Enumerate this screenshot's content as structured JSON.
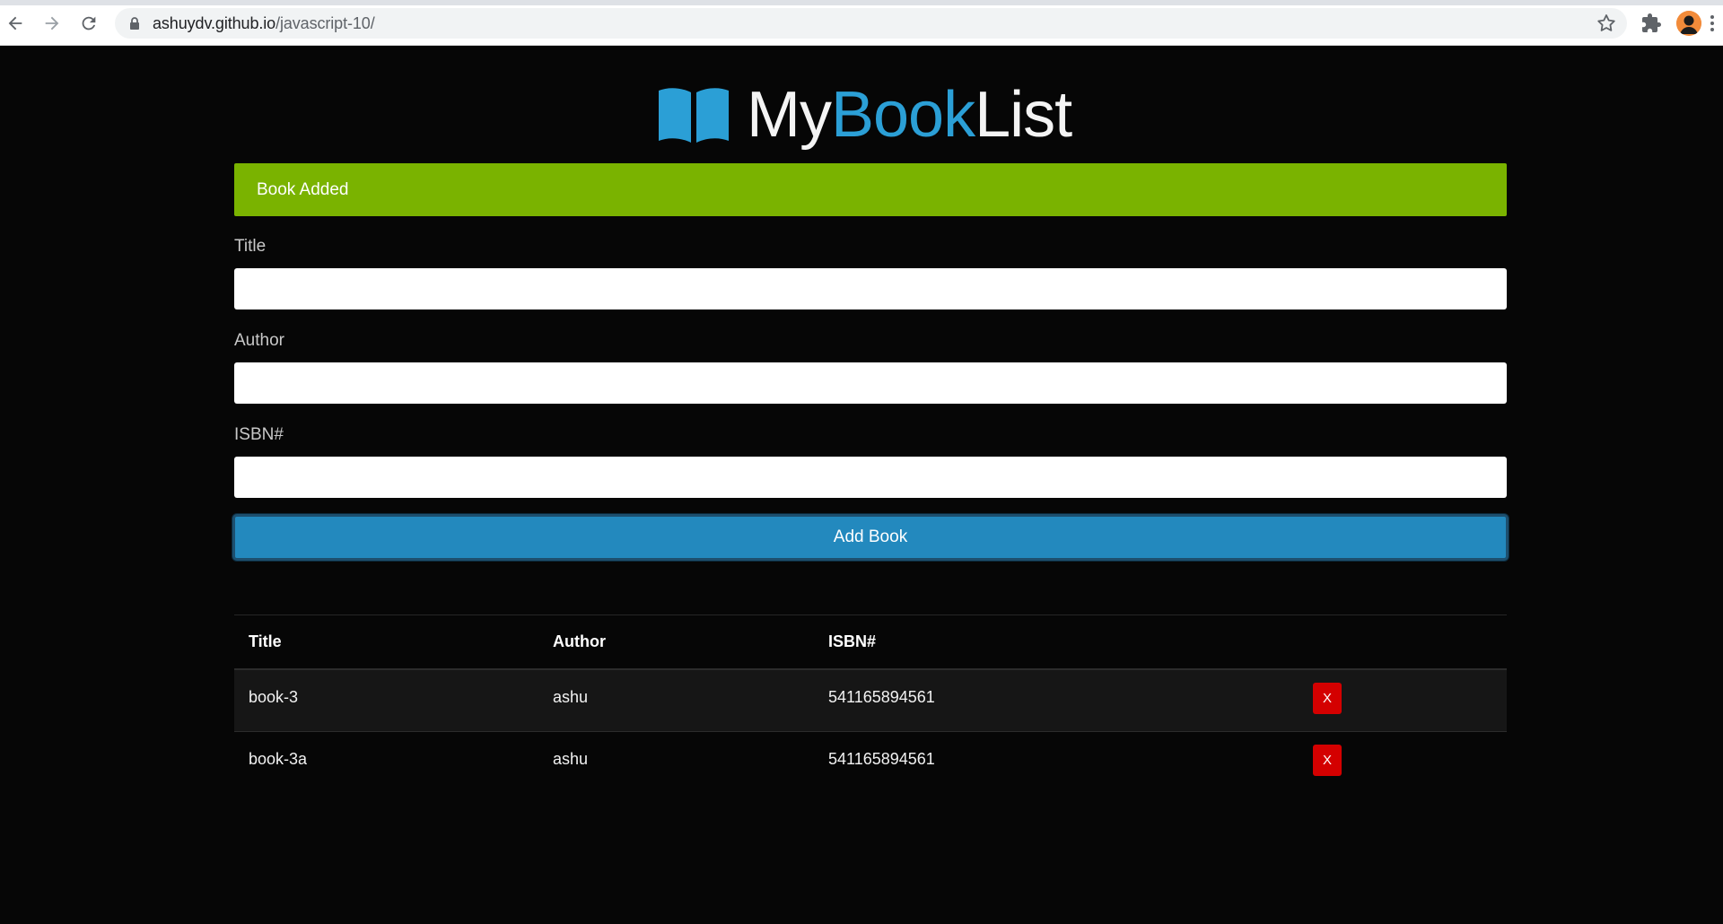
{
  "browser": {
    "url_host": "ashuydv.github.io",
    "url_path": "/javascript-10/"
  },
  "header": {
    "brand_my": "My",
    "brand_book": "Book",
    "brand_list": "List"
  },
  "alert": {
    "message": "Book Added",
    "color": "#7ab300"
  },
  "form": {
    "title_label": "Title",
    "title_value": "",
    "author_label": "Author",
    "author_value": "",
    "isbn_label": "ISBN#",
    "isbn_value": "",
    "submit_label": "Add Book"
  },
  "table": {
    "headers": [
      "Title",
      "Author",
      "ISBN#",
      ""
    ],
    "rows": [
      {
        "title": "book-3",
        "author": "ashu",
        "isbn": "541165894561",
        "delete_label": "X"
      },
      {
        "title": "book-3a",
        "author": "ashu",
        "isbn": "541165894561",
        "delete_label": "X"
      }
    ]
  },
  "colors": {
    "accent": "#2b9fd6",
    "button": "#2389be",
    "delete": "#d40000"
  }
}
